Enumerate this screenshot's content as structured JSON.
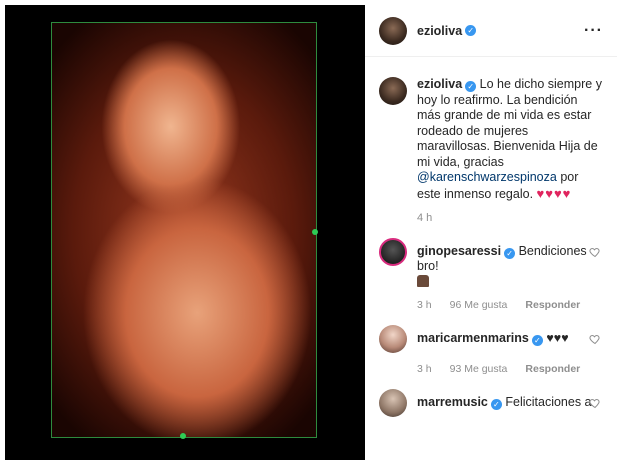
{
  "post": {
    "username": "ezioliva",
    "caption_prefix": "Lo he dicho siempre y hoy lo reafirmo. La bendición más grande de mi vida es estar rodeado de mujeres maravillosas. Bienvenida Hija de mi vida, gracias ",
    "caption_mention": "@karenschwarzespinoza",
    "caption_suffix": " por este inmenso regalo. ",
    "caption_hearts": "♥♥♥♥",
    "time": "4 h"
  },
  "comments": [
    {
      "username": "ginopesaressi",
      "text": "Bendiciones bro!",
      "time": "3 h",
      "likes": "96 Me gusta",
      "reply": "Responder"
    },
    {
      "username": "maricarmenmarins",
      "text": "♥♥♥",
      "time": "3 h",
      "likes": "93 Me gusta",
      "reply": "Responder"
    },
    {
      "username": "marremusic",
      "text": "Felicitaciones a"
    }
  ],
  "icons": {
    "verified": "verified-badge",
    "more": "more-options-icon",
    "like": "heart-outline-icon"
  },
  "colors": {
    "verified": "#3897f0",
    "mention": "#00376b",
    "heart": "#e0245e",
    "frame_border": "#2e8b3e"
  }
}
